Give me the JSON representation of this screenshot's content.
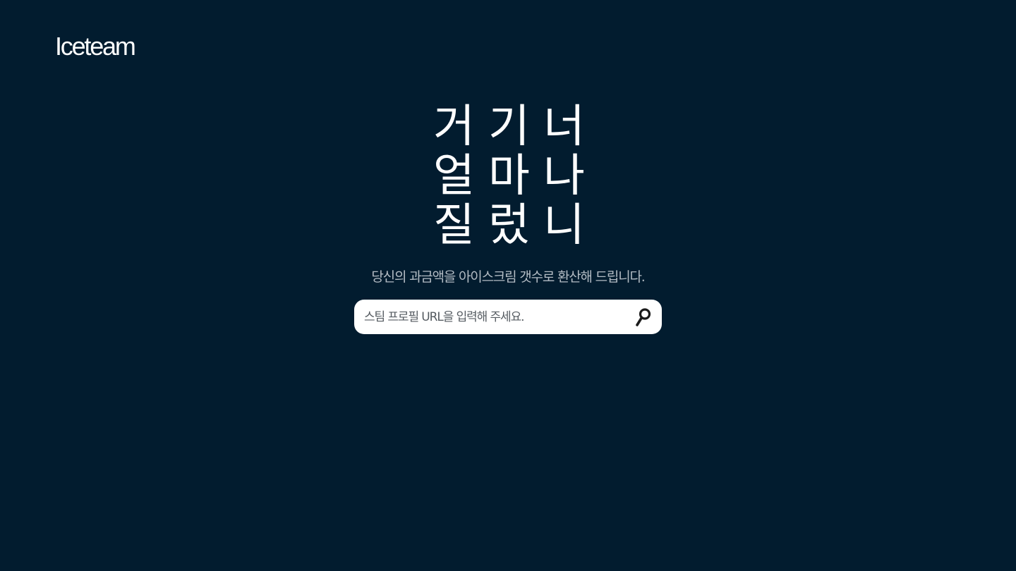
{
  "header": {
    "logo": "Iceteam"
  },
  "hero": {
    "lines": [
      [
        "거",
        "기",
        "너"
      ],
      [
        "얼",
        "마",
        "나"
      ],
      [
        "질",
        "렀",
        "니"
      ]
    ]
  },
  "subtitle": "당신의 과금액을 아이스크림 갯수로 환산해 드립니다.",
  "search": {
    "placeholder": "스팀 프로필 URL을 입력해 주세요.",
    "value": "",
    "icon": "search-icon"
  },
  "colors": {
    "background": "#021c2f",
    "text": "#ffffff",
    "subtitle": "#b4bcc4",
    "search_bg": "#ffffff",
    "icon": "#1c1c1c"
  }
}
